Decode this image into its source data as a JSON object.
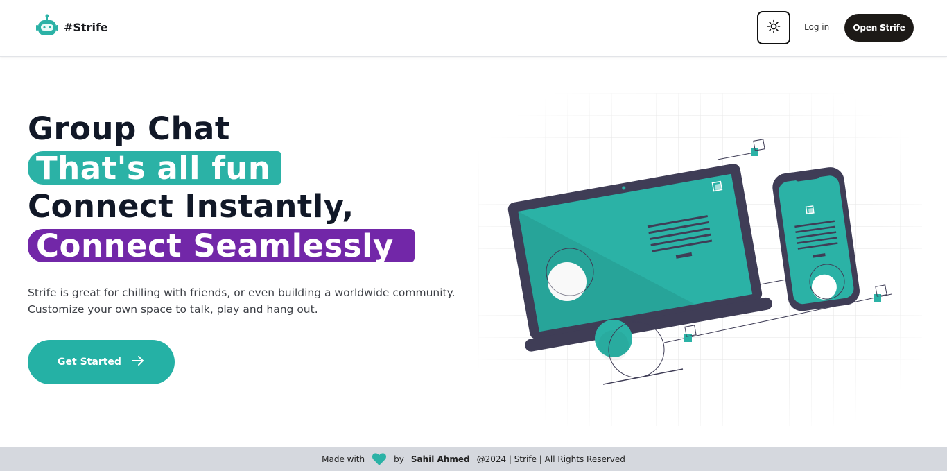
{
  "header": {
    "brand": "#Strife",
    "login": "Log in",
    "open_button": "Open Strife",
    "theme_icon": "sun-icon",
    "logo_icon": "robot-icon"
  },
  "hero": {
    "line1": "Group Chat",
    "line2": "That's all fun",
    "line3": "Connect Instantly,",
    "line4": "Connect Seamlessly",
    "description_1": "Strife is great for chilling with friends, or even building a worldwide community.",
    "description_2": "Customize your own space to talk, play and hang out.",
    "cta": "Get Started",
    "cta_icon": "arrow-right-icon"
  },
  "footer": {
    "made_with": "Made with",
    "by": "by",
    "author": "Sahil Ahmed",
    "rights": "@2024 | Strife | All Rights Reserved",
    "heart_icon": "heart-icon"
  },
  "colors": {
    "teal": "#2bb2a6",
    "purple": "#7227a8",
    "dark": "#1d1a17",
    "device": "#3f3d56"
  }
}
